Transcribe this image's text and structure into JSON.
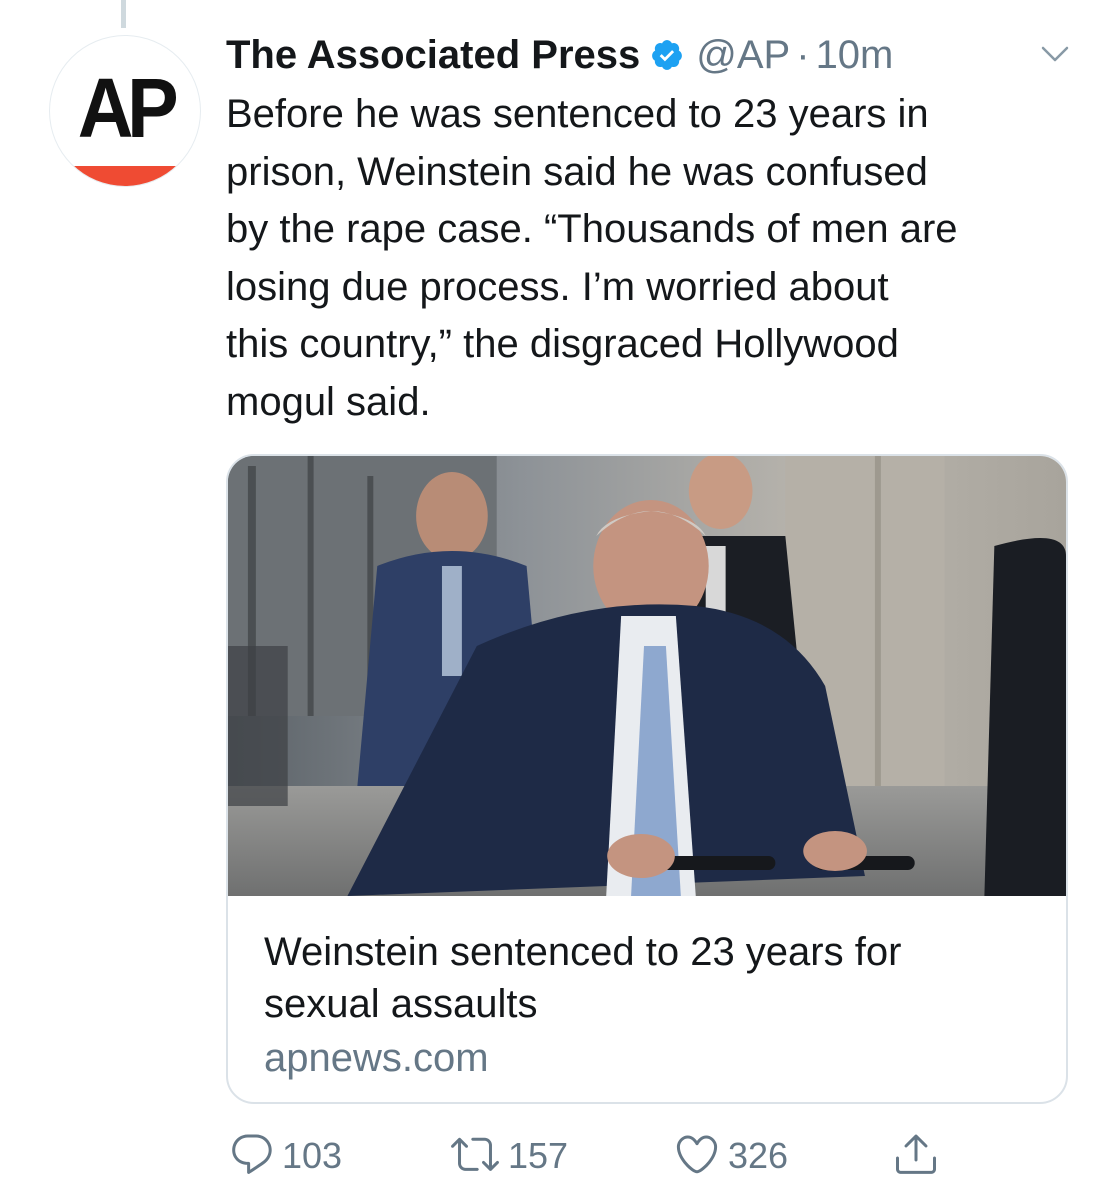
{
  "tweet": {
    "author_name": "The Associated Press",
    "handle": "@AP",
    "separator": "·",
    "timestamp": "10m",
    "avatar_logo_text": "AP",
    "text": "Before he was sentenced to 23 years in\nprison, Weinstein said he was confused\nby the rape case. “Thousands of men are\nlosing due process. I’m worried about\nthis country,” the disgraced Hollywood\nmogul said."
  },
  "link_card": {
    "title": "Weinstein sentenced to 23 years for sexual assaults",
    "domain": "apnews.com",
    "image_icon": "news-photo"
  },
  "actions": {
    "reply": {
      "icon": "reply-icon",
      "count": "103"
    },
    "retweet": {
      "icon": "retweet-icon",
      "count": "157"
    },
    "like": {
      "icon": "heart-icon",
      "count": "326"
    },
    "share": {
      "icon": "share-icon"
    }
  },
  "colors": {
    "text": "#14171a",
    "secondary": "#657786",
    "verified": "#1da1f2",
    "ap_red": "#ef4b33",
    "card_border": "#dbe2e8"
  }
}
